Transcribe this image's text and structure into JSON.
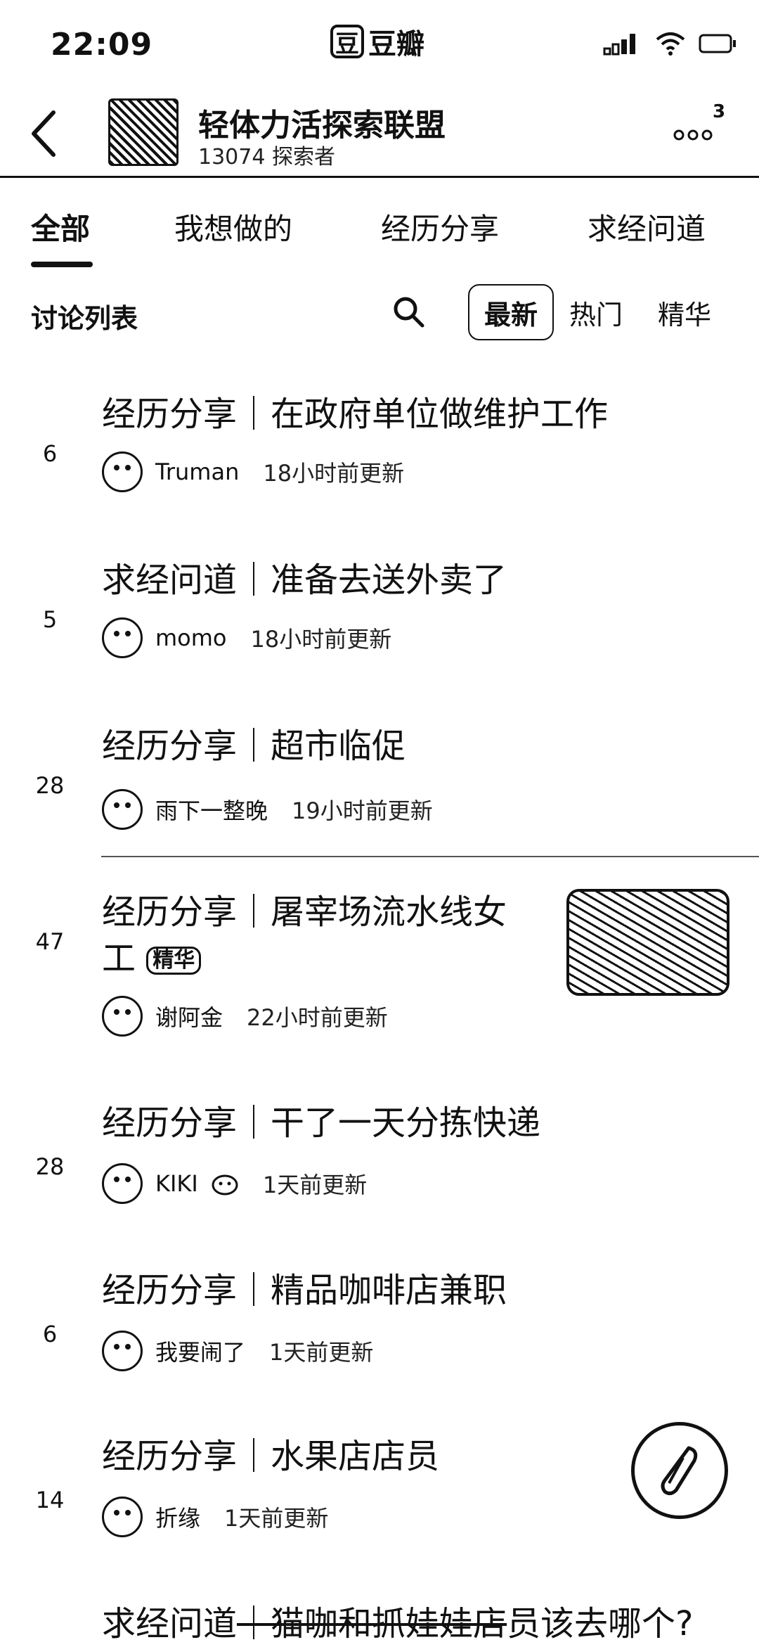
{
  "status_bar": {
    "time": "22:09",
    "app_badge": "豆",
    "app_name": "豆瓣"
  },
  "header": {
    "group_name": "轻体力活探索联盟",
    "member_info": "13074 探索者",
    "notification_count": "3"
  },
  "tabs": [
    {
      "label": "全部"
    },
    {
      "label": "我想做的"
    },
    {
      "label": "经历分享"
    },
    {
      "label": "求经问道"
    }
  ],
  "filters": {
    "list_title": "讨论列表",
    "sort_options": [
      "最新",
      "热门",
      "精华"
    ]
  },
  "posts": [
    {
      "count": "6",
      "title": "经历分享｜在政府单位做维护工作",
      "author": "Truman",
      "time": "18小时前更新"
    },
    {
      "count": "5",
      "title": "求经问道｜准备去送外卖了",
      "author": "momo",
      "time": "18小时前更新"
    },
    {
      "count": "28",
      "title": "经历分享｜超市临促",
      "author": "雨下一整晚",
      "time": "19小时前更新"
    },
    {
      "count": "47",
      "title_line1": "经历分享｜屠宰场流水线女",
      "title_line2": "工",
      "tag": "精华",
      "author": "谢阿金",
      "time": "22小时前更新"
    },
    {
      "count": "28",
      "title": "经历分享｜干了一天分拣快递",
      "author": "KIKI",
      "time": "1天前更新"
    },
    {
      "count": "6",
      "title": "经历分享｜精品咖啡店兼职",
      "author": "我要闹了",
      "time": "1天前更新"
    },
    {
      "count": "14",
      "title": "经历分享｜水果店店员",
      "author": "折缘",
      "time": "1天前更新"
    },
    {
      "title_prefix": "求经问道",
      "title_struck": "｜猫咖和抓娃娃店",
      "title_suffix": "员该去哪个?"
    }
  ]
}
